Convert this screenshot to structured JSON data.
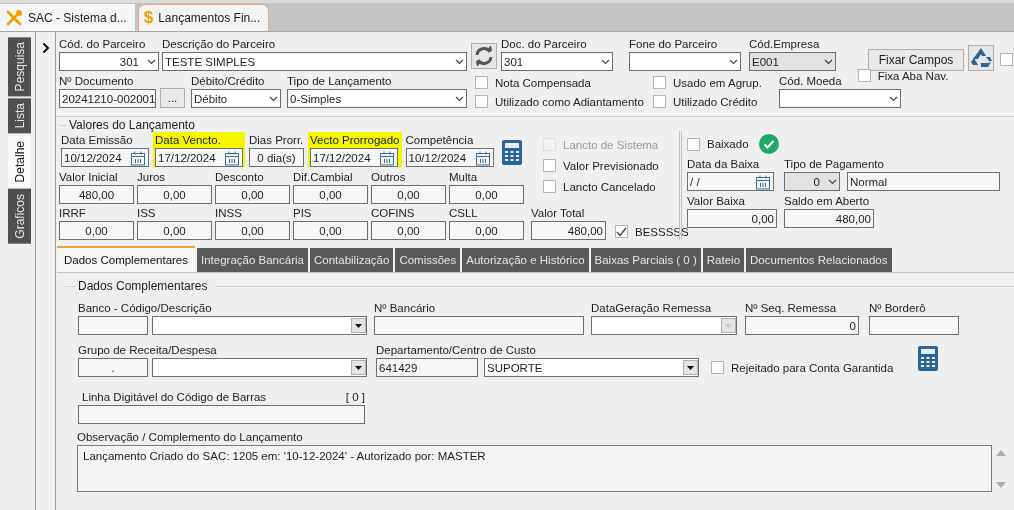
{
  "app_tabs": [
    {
      "label": "SAC - Sistema d...",
      "kind": "tools",
      "selected": false
    },
    {
      "label": "Lançamentos Fin...",
      "kind": "glyph",
      "glyph": "$",
      "selected": true
    }
  ],
  "side_tabs": [
    {
      "label": "Pesquisa",
      "selected": false
    },
    {
      "label": "Lista",
      "selected": false
    },
    {
      "label": "Detalhe",
      "selected": true
    },
    {
      "label": "Graficos",
      "selected": false
    }
  ],
  "partner_code": {
    "label": "Cód. do Parceiro",
    "value": "301"
  },
  "partner_description": {
    "label": "Descrição do Parceiro",
    "value": "TESTE SIMPLES"
  },
  "partner_document": {
    "label": "Doc. do Parceiro",
    "value": "301"
  },
  "partner_phone": {
    "label": "Fone do Parceiro"
  },
  "company_code": {
    "label": "Cód.Empresa",
    "value": "E001",
    "disabled": true
  },
  "fix_fields_button": "Fixar Campos",
  "edge_checkbox": {
    "checked": false
  },
  "document_number": {
    "label": "Nº Documento",
    "value": "20241210-002001"
  },
  "document_lookup_button": "...",
  "debit_credit": {
    "label": "Débito/Crédito",
    "value": "Débito"
  },
  "entry_type": {
    "label": "Tipo de Lançamento",
    "value": "0-Simples"
  },
  "header_flags": [
    {
      "label": "Nota Compensada",
      "checked": false
    },
    {
      "label": "Utilizado como Adiantamento",
      "checked": false
    },
    {
      "label": "Usado em Agrup.",
      "checked": false
    },
    {
      "label": "Utilizado Crédito",
      "checked": false
    }
  ],
  "currency_code": {
    "label": "Cód. Moeda"
  },
  "fix_nav_tab": {
    "label": "Fixa Aba Nav.",
    "checked": false
  },
  "values_section": {
    "title": "Valores do Lançamento",
    "dates": [
      {
        "kind": "date",
        "label": "Data Emissão",
        "value": "10/12/2024",
        "highlighted": false
      },
      {
        "kind": "date",
        "label": "Data Vencto.",
        "value": "17/12/2024",
        "highlighted": true
      },
      {
        "kind": "days",
        "label": "Dias Prorr.",
        "value": "0 dia(s)",
        "highlighted": false
      },
      {
        "kind": "date",
        "label": "Vecto Prorrogado",
        "value": "17/12/2024",
        "highlighted": true
      },
      {
        "kind": "date",
        "label": "Competência",
        "value": "10/12/2024",
        "highlighted": false
      }
    ],
    "flags": [
      {
        "label": "Lancto de Sistema",
        "checked": false,
        "disabled": true
      },
      {
        "label": "Valor Previsionado",
        "checked": false,
        "disabled": false
      },
      {
        "label": "Lancto Cancelado",
        "checked": false,
        "disabled": false
      }
    ],
    "amounts": [
      {
        "label": "Valor Inicial",
        "value": "480,00"
      },
      {
        "label": "Juros",
        "value": "0,00"
      },
      {
        "label": "Desconto",
        "value": "0,00"
      },
      {
        "label": "Dif.Cambial",
        "value": "0,00"
      },
      {
        "label": "Outros",
        "value": "0,00"
      },
      {
        "label": "Multa",
        "value": "0,00"
      }
    ],
    "taxes": [
      {
        "label": "IRRF",
        "value": "0,00"
      },
      {
        "label": "ISS",
        "value": "0,00"
      },
      {
        "label": "INSS",
        "value": "0,00"
      },
      {
        "label": "PIS",
        "value": "0,00"
      },
      {
        "label": "COFINS",
        "value": "0,00"
      },
      {
        "label": "CSLL",
        "value": "0,00"
      }
    ],
    "total": {
      "label": "Valor Total",
      "value": "480,00"
    },
    "besssss": {
      "label": "BESSSSS",
      "checked": true
    }
  },
  "settlement": {
    "settled": {
      "label": "Baixado",
      "checked": false
    },
    "settlement_date": {
      "label": "Data da Baixa",
      "value": "/ /"
    },
    "payment_type": {
      "label": "Tipo de Pagamento",
      "code": "0",
      "description": "Normal"
    },
    "settled_amount": {
      "label": "Valor Baixa",
      "value": "0,00"
    },
    "open_balance": {
      "label": "Saldo em Aberto",
      "value": "480,00"
    }
  },
  "detail_tabs": [
    {
      "label": "Dados Complementares",
      "selected": true
    },
    {
      "label": "Integração Bancária",
      "selected": false
    },
    {
      "label": "Contabilização",
      "selected": false
    },
    {
      "label": "Comissões",
      "selected": false
    },
    {
      "label": "Autorização e Histórico",
      "selected": false
    },
    {
      "label": "Baixas Parciais ( 0 )",
      "selected": false
    },
    {
      "label": "Rateio",
      "selected": false
    },
    {
      "label": "Documentos Relacionados",
      "selected": false
    }
  ],
  "complementary": {
    "title": "Dados Complementares",
    "bank": {
      "label": "Banco - Código/Descrição"
    },
    "bank_number": {
      "label": "Nº Bancário"
    },
    "remittance_date": {
      "label": "DataGeração Remessa"
    },
    "remittance_sequence": {
      "label": "Nº Seq. Remessa",
      "value": "0"
    },
    "bordero_number": {
      "label": "Nº Borderô"
    },
    "revenue_group": {
      "label": "Grupo de Receita/Despesa",
      "code": "."
    },
    "cost_center": {
      "label": "Departamento/Centro de Custo",
      "code": "641429",
      "description": "SUPORTE"
    },
    "rejected": {
      "label": "Rejeitado para Conta Garantida",
      "checked": false
    },
    "barcode": {
      "label": "Linha Digitável do Código de Barras",
      "count": "[ 0 ]"
    },
    "notes": {
      "label": "Observação / Complemento do Lançamento",
      "value": "Lançamento Criado do SAC: 1205 em: '10-12-2024' - Autorizado por: MASTER"
    }
  }
}
